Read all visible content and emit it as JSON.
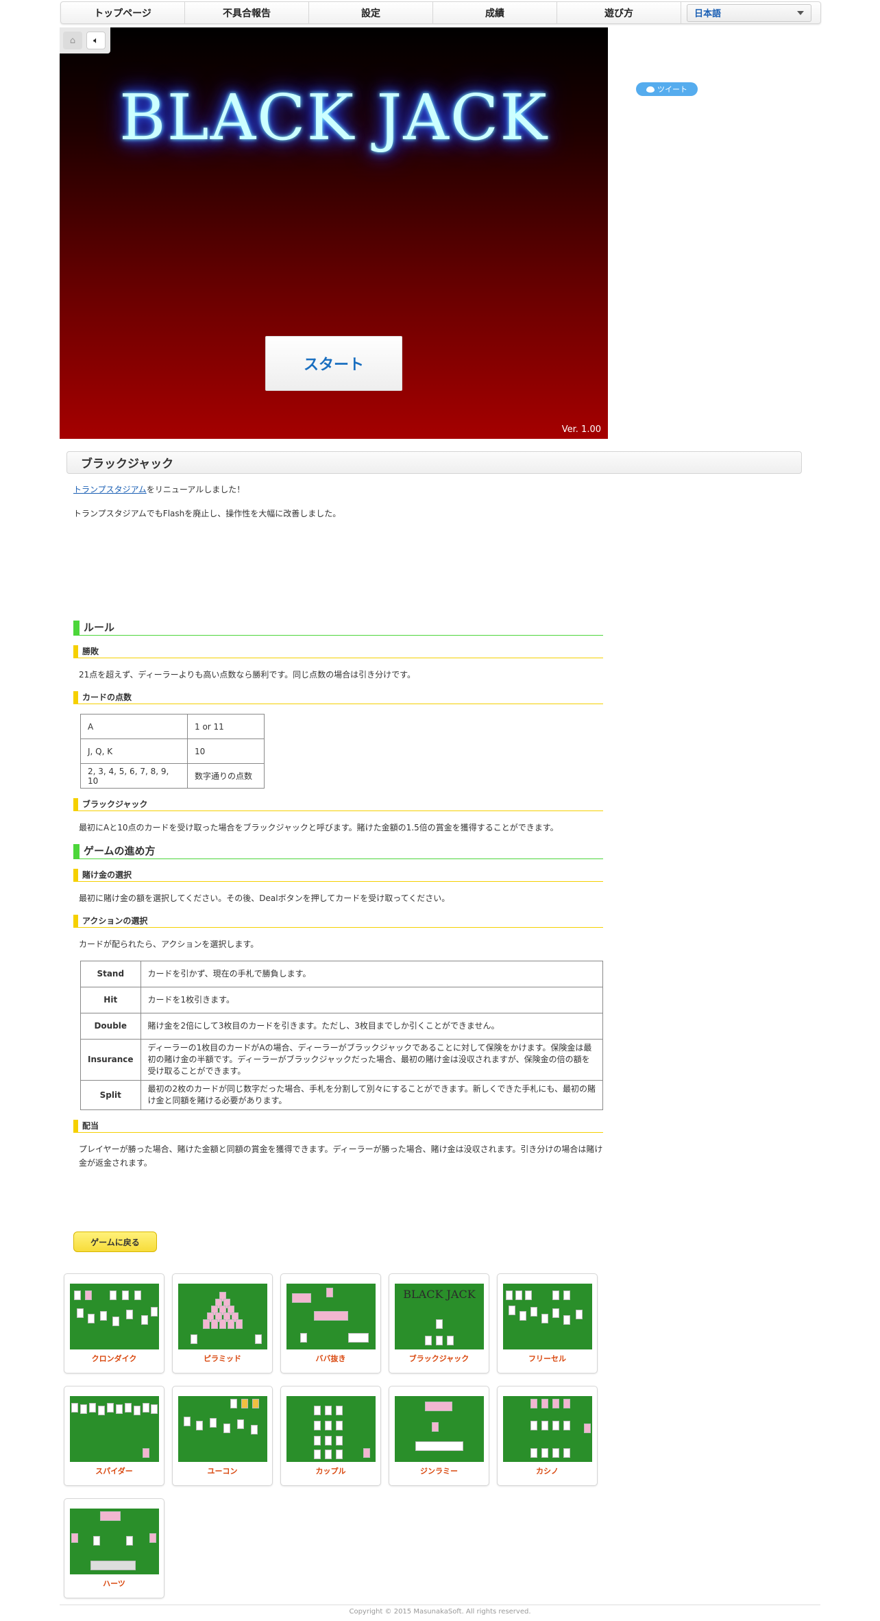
{
  "nav": {
    "items": [
      "トップページ",
      "不具合報告",
      "設定",
      "成績",
      "遊び方"
    ],
    "language": "日本語"
  },
  "game": {
    "title": "BLACK JACK",
    "start_label": "スタート",
    "version": "Ver. 1.00",
    "home_icon": "home-icon",
    "sound_icon": "speaker-icon"
  },
  "tweet_label": "ツイート",
  "page_title": "ブラックジャック",
  "intro": {
    "link_text": "トランプスタジアム",
    "line1_rest": "をリニューアルしました！",
    "line2": "トランプスタジアムでもFlashを廃止し、操作性を大幅に改善しました。"
  },
  "rules": {
    "heading": "ルール",
    "win": {
      "heading": "勝敗",
      "text": "21点を超えず、ディーラーよりも高い点数なら勝利です。同じ点数の場合は引き分けです。"
    },
    "points": {
      "heading": "カードの点数",
      "rows": [
        [
          "A",
          "1 or 11"
        ],
        [
          "J, Q, K",
          "10"
        ],
        [
          "2, 3, 4, 5, 6, 7, 8, 9, 10",
          "数字通りの点数"
        ]
      ]
    },
    "blackjack": {
      "heading": "ブラックジャック",
      "text": "最初にAと10点のカードを受け取った場合をブラックジャックと呼びます。賭けた金額の1.5倍の賞金を獲得することができます。"
    }
  },
  "howto": {
    "heading": "ゲームの進め方",
    "bet": {
      "heading": "賭け金の選択",
      "text": "最初に賭け金の額を選択してください。その後、Dealボタンを押してカードを受け取ってください。"
    },
    "action": {
      "heading": "アクションの選択",
      "text": "カードが配られたら、アクションを選択します。",
      "rows": [
        [
          "Stand",
          "カードを引かず、現在の手札で勝負します。"
        ],
        [
          "Hit",
          "カードを1枚引きます。"
        ],
        [
          "Double",
          "賭け金を2倍にして3枚目のカードを引きます。ただし、3枚目までしか引くことができません。"
        ],
        [
          "Insurance",
          "ディーラーの1枚目のカードがAの場合、ディーラーがブラックジャックであることに対して保険をかけます。保険金は最初の賭け金の半額です。ディーラーがブラックジャックだった場合、最初の賭け金は没収されますが、保険金の倍の額を受け取ることができます。"
        ],
        [
          "Split",
          "最初の2枚のカードが同じ数字だった場合、手札を分割して別々にすることができます。新しくできた手札にも、最初の賭け金と同額を賭ける必要があります。"
        ]
      ]
    },
    "payout": {
      "heading": "配当",
      "text": "プレイヤーが勝った場合、賭けた金額と同額の賞金を獲得できます。ディーラーが勝った場合、賭け金は没収されます。引き分けの場合は賭け金が返金されます。"
    }
  },
  "back_label": "ゲームに戻る",
  "games": [
    "クロンダイク",
    "ピラミッド",
    "ババ抜き",
    "ブラックジャック",
    "フリーセル",
    "スパイダー",
    "ユーコン",
    "カップル",
    "ジンラミー",
    "カシノ",
    "ハーツ"
  ],
  "thumb_bj_text": "BLACK JACK",
  "footer": "Copyright © 2015 MasunakaSoft. All rights reserved."
}
